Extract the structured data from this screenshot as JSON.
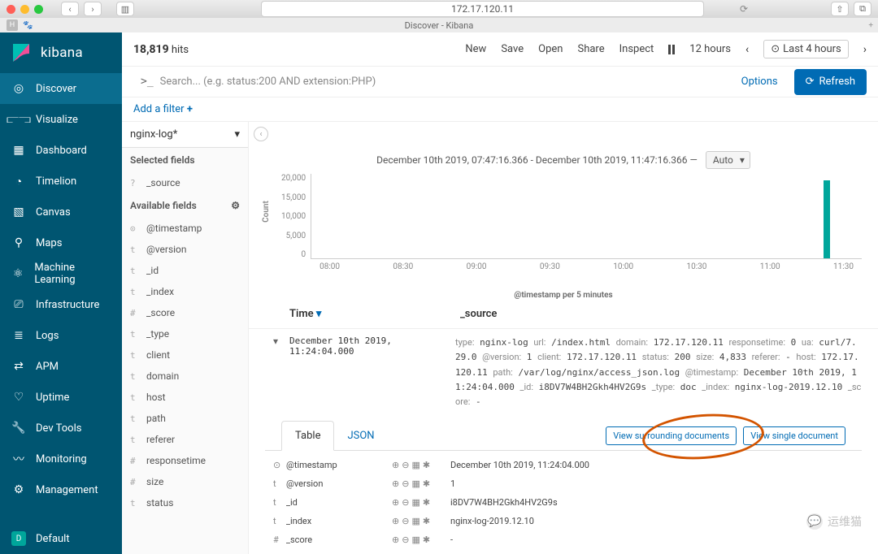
{
  "browser": {
    "url": "172.17.120.11",
    "tab_title": "Discover - Kibana"
  },
  "brand": "kibana",
  "nav": [
    {
      "label": "Discover",
      "icon": "compass",
      "active": true
    },
    {
      "label": "Visualize",
      "icon": "chart"
    },
    {
      "label": "Dashboard",
      "icon": "dashboard"
    },
    {
      "label": "Timelion",
      "icon": "timelion"
    },
    {
      "label": "Canvas",
      "icon": "canvas"
    },
    {
      "label": "Maps",
      "icon": "map"
    },
    {
      "label": "Machine Learning",
      "icon": "ml"
    },
    {
      "label": "Infrastructure",
      "icon": "infra"
    },
    {
      "label": "Logs",
      "icon": "logs"
    },
    {
      "label": "APM",
      "icon": "apm"
    },
    {
      "label": "Uptime",
      "icon": "uptime"
    },
    {
      "label": "Dev Tools",
      "icon": "wrench"
    },
    {
      "label": "Monitoring",
      "icon": "monitor"
    },
    {
      "label": "Management",
      "icon": "gear"
    }
  ],
  "default_label": "Default",
  "hits": {
    "count": "18,819",
    "label": "hits"
  },
  "top_actions": [
    "New",
    "Save",
    "Open",
    "Share",
    "Inspect"
  ],
  "time_amount": "12 hours",
  "time_last": "Last 4 hours",
  "search_placeholder": "Search... (e.g. status:200 AND extension:PHP)",
  "options_label": "Options",
  "refresh_label": "Refresh",
  "add_filter": "Add a filter",
  "index_pattern": "nginx-log*",
  "selected_fields_label": "Selected fields",
  "available_fields_label": "Available fields",
  "selected_fields": [
    {
      "type": "?",
      "name": "_source"
    }
  ],
  "available_fields": [
    {
      "type": "⊙",
      "name": "@timestamp"
    },
    {
      "type": "t",
      "name": "@version"
    },
    {
      "type": "t",
      "name": "_id"
    },
    {
      "type": "t",
      "name": "_index"
    },
    {
      "type": "#",
      "name": "_score"
    },
    {
      "type": "t",
      "name": "_type"
    },
    {
      "type": "t",
      "name": "client"
    },
    {
      "type": "t",
      "name": "domain"
    },
    {
      "type": "t",
      "name": "host"
    },
    {
      "type": "t",
      "name": "path"
    },
    {
      "type": "t",
      "name": "referer"
    },
    {
      "type": "#",
      "name": "responsetime"
    },
    {
      "type": "#",
      "name": "size"
    },
    {
      "type": "t",
      "name": "status"
    }
  ],
  "timerange": "December 10th 2019, 07:47:16.366 - December 10th 2019, 11:47:16.366 —",
  "interval": "Auto",
  "chart_data": {
    "type": "bar",
    "ylabel": "Count",
    "xlabel": "@timestamp per 5 minutes",
    "yticks": [
      "20,000",
      "15,000",
      "10,000",
      "5,000",
      "0"
    ],
    "xticks": [
      "08:00",
      "08:30",
      "09:00",
      "09:30",
      "10:00",
      "10:30",
      "11:00",
      "11:30"
    ],
    "ylim": [
      0,
      20000
    ],
    "bars": [
      {
        "x_pct": 93,
        "value": 18500
      }
    ]
  },
  "cols": {
    "time": "Time",
    "source": "_source"
  },
  "row": {
    "time": "December 10th 2019, 11:24:04.000",
    "source_pairs": [
      [
        "type:",
        "nginx-log"
      ],
      [
        "url:",
        "/index.html"
      ],
      [
        "domain:",
        "172.17.120.11"
      ],
      [
        "responsetime:",
        "0"
      ],
      [
        "ua:",
        "curl/7.29.0"
      ],
      [
        "@version:",
        "1"
      ],
      [
        "client:",
        "172.17.120.11"
      ],
      [
        "status:",
        "200"
      ],
      [
        "size:",
        "4,833"
      ],
      [
        "referer:",
        "-"
      ],
      [
        "host:",
        "172.17.120.11"
      ],
      [
        "path:",
        "/var/log/nginx/access_json.log"
      ],
      [
        "@timestamp:",
        "December 10th 2019, 11:24:04.000"
      ],
      [
        "_id:",
        "i8DV7W4BH2Gkh4HV2G9s"
      ],
      [
        "_type:",
        "doc"
      ],
      [
        "_index:",
        "nginx-log-2019.12.10"
      ],
      [
        "_score:",
        "-"
      ]
    ]
  },
  "detail_tabs": {
    "table": "Table",
    "json": "JSON"
  },
  "view_surrounding": "View surrounding documents",
  "view_single": "View single document",
  "detail_fields": [
    {
      "icon": "⊙",
      "name": "@timestamp",
      "value": "December 10th 2019, 11:24:04.000"
    },
    {
      "icon": "t",
      "name": "@version",
      "value": "1"
    },
    {
      "icon": "t",
      "name": "_id",
      "value": "i8DV7W4BH2Gkh4HV2G9s"
    },
    {
      "icon": "t",
      "name": "_index",
      "value": "nginx-log-2019.12.10"
    },
    {
      "icon": "#",
      "name": "_score",
      "value": "-"
    }
  ],
  "watermark": "运维猫"
}
